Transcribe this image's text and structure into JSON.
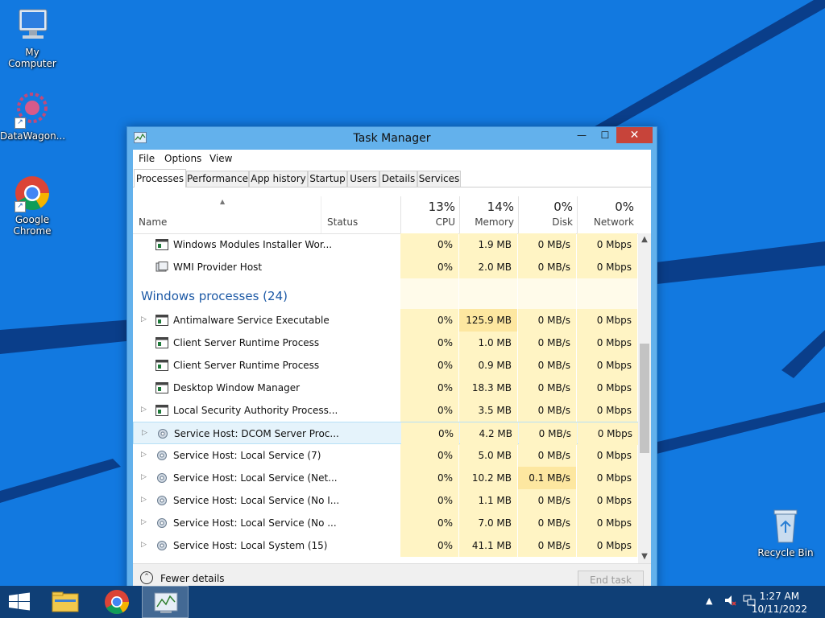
{
  "desktop": {
    "icons": [
      {
        "label": "My Computer",
        "icon": "computer-icon"
      },
      {
        "label": "DataWagon...",
        "icon": "datawagon-icon"
      },
      {
        "label": "Google Chrome",
        "icon": "chrome-icon"
      },
      {
        "label": "Recycle Bin",
        "icon": "recycle-bin-icon"
      }
    ]
  },
  "window": {
    "title": "Task Manager",
    "close_glyph": "✕",
    "menu": [
      "File",
      "Options",
      "View"
    ],
    "tabs": [
      "Processes",
      "Performance",
      "App history",
      "Startup",
      "Users",
      "Details",
      "Services"
    ],
    "active_tab": "Processes",
    "columns": {
      "name": "Name",
      "status": "Status",
      "cpu": {
        "pct": "13%",
        "label": "CPU"
      },
      "memory": {
        "pct": "14%",
        "label": "Memory"
      },
      "disk": {
        "pct": "0%",
        "label": "Disk"
      },
      "network": {
        "pct": "0%",
        "label": "Network"
      }
    },
    "rows": [
      {
        "name": "Windows Modules Installer Wor...",
        "cpu": "0%",
        "memory": "1.9 MB",
        "disk": "0 MB/s",
        "network": "0 Mbps"
      },
      {
        "name": "WMI Provider Host",
        "cpu": "0%",
        "memory": "2.0 MB",
        "disk": "0 MB/s",
        "network": "0 Mbps"
      }
    ],
    "group_title": "Windows processes (24)",
    "group_rows": [
      {
        "name": "Antimalware Service Executable",
        "cpu": "0%",
        "memory": "125.9 MB",
        "disk": "0 MB/s",
        "network": "0 Mbps"
      },
      {
        "name": "Client Server Runtime Process",
        "cpu": "0%",
        "memory": "1.0 MB",
        "disk": "0 MB/s",
        "network": "0 Mbps"
      },
      {
        "name": "Client Server Runtime Process",
        "cpu": "0%",
        "memory": "0.9 MB",
        "disk": "0 MB/s",
        "network": "0 Mbps"
      },
      {
        "name": "Desktop Window Manager",
        "cpu": "0%",
        "memory": "18.3 MB",
        "disk": "0 MB/s",
        "network": "0 Mbps"
      },
      {
        "name": "Local Security Authority Process...",
        "cpu": "0%",
        "memory": "3.5 MB",
        "disk": "0 MB/s",
        "network": "0 Mbps"
      },
      {
        "name": "Service Host: DCOM Server Proc...",
        "cpu": "0%",
        "memory": "4.2 MB",
        "disk": "0 MB/s",
        "network": "0 Mbps"
      },
      {
        "name": "Service Host: Local Service (7)",
        "cpu": "0%",
        "memory": "5.0 MB",
        "disk": "0 MB/s",
        "network": "0 Mbps"
      },
      {
        "name": "Service Host: Local Service (Net...",
        "cpu": "0%",
        "memory": "10.2 MB",
        "disk": "0.1 MB/s",
        "network": "0 Mbps"
      },
      {
        "name": "Service Host: Local Service (No I...",
        "cpu": "0%",
        "memory": "1.1 MB",
        "disk": "0 MB/s",
        "network": "0 Mbps"
      },
      {
        "name": "Service Host: Local Service (No ...",
        "cpu": "0%",
        "memory": "7.0 MB",
        "disk": "0 MB/s",
        "network": "0 Mbps"
      },
      {
        "name": "Service Host: Local System (15)",
        "cpu": "0%",
        "memory": "41.1 MB",
        "disk": "0 MB/s",
        "network": "0 Mbps"
      }
    ],
    "footer": {
      "fewer_details": "Fewer details",
      "end_task": "End task"
    }
  },
  "taskbar": {
    "time": "1:27 AM",
    "date": "10/11/2022",
    "items": [
      "start-icon",
      "file-explorer-icon",
      "chrome-icon",
      "task-manager-icon"
    ]
  },
  "colors": {
    "desktop": "#1279e0",
    "taskbar": "#0f3f76",
    "heat": "#fff4c4",
    "heat2": "#fde7a0",
    "group": "#1e5aa6"
  }
}
